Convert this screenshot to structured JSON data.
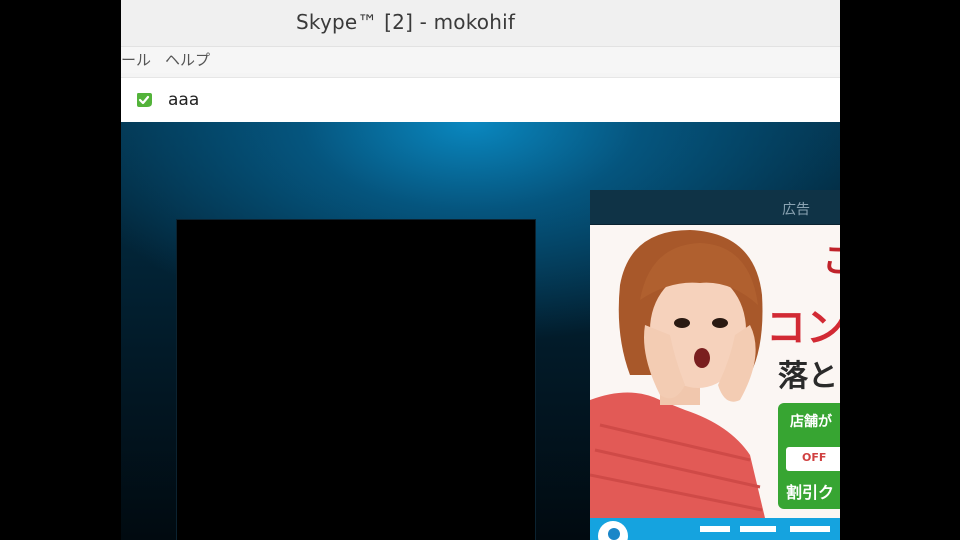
{
  "window": {
    "title": "Skype™ [2] - mokohif"
  },
  "menu": {
    "items": [
      "ール",
      "ヘルプ"
    ]
  },
  "contact": {
    "name": "aaa"
  },
  "ad": {
    "label": "広告",
    "headline_lines": [
      "こ",
      "コン",
      "落と"
    ],
    "badge_top": "店舗が",
    "badge_off": "OFF",
    "badge_bottom": "割引ク"
  },
  "colors": {
    "status_online": "#53b33a",
    "call_bg_dark": "#021a28",
    "ad_bottom_bar": "#15a3df",
    "ad_green": "#37a532"
  }
}
